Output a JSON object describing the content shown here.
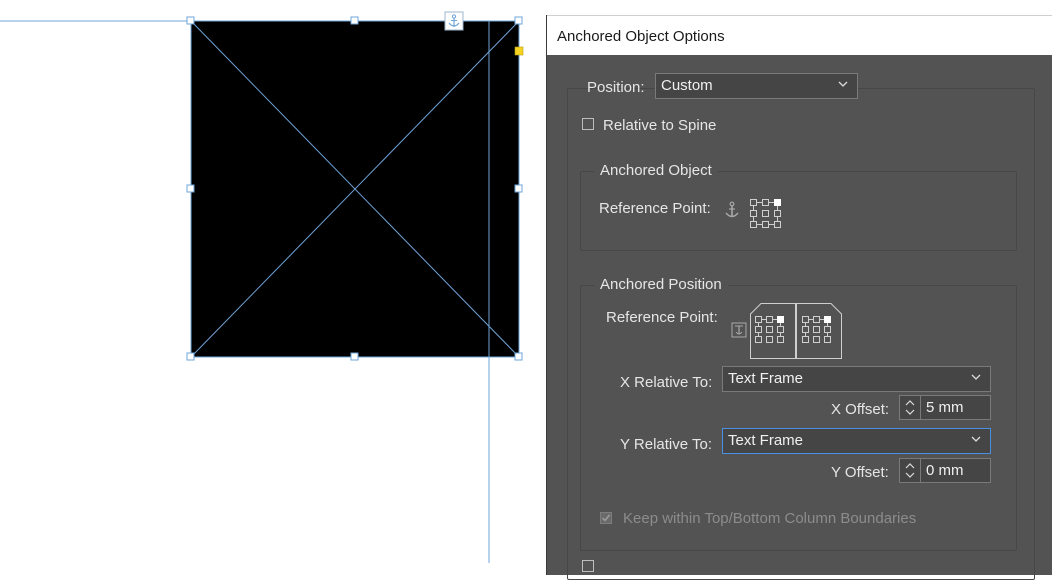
{
  "canvas": {
    "guide_color": "#6fa4d8",
    "frame_fill": "#000000",
    "anchor_marker_icon": "anchor-icon",
    "overset_marker_color": "#f5d320"
  },
  "dialog": {
    "title": "Anchored Object Options",
    "position_label": "Position:",
    "position_value": "Custom",
    "relative_to_spine_label": "Relative to Spine",
    "relative_to_spine_checked": false,
    "anchored_object": {
      "group_label": "Anchored Object",
      "reference_point_label": "Reference Point:"
    },
    "anchored_position": {
      "group_label": "Anchored Position",
      "reference_point_label": "Reference Point:",
      "x_relative_label": "X Relative To:",
      "x_relative_value": "Text Frame",
      "x_offset_label": "X Offset:",
      "x_offset_value": "5 mm",
      "y_relative_label": "Y Relative To:",
      "y_relative_value": "Text Frame",
      "y_offset_label": "Y Offset:",
      "y_offset_value": "0 mm",
      "keep_within_label": "Keep within Top/Bottom Column Boundaries",
      "keep_within_checked": true,
      "keep_within_enabled": false
    }
  }
}
